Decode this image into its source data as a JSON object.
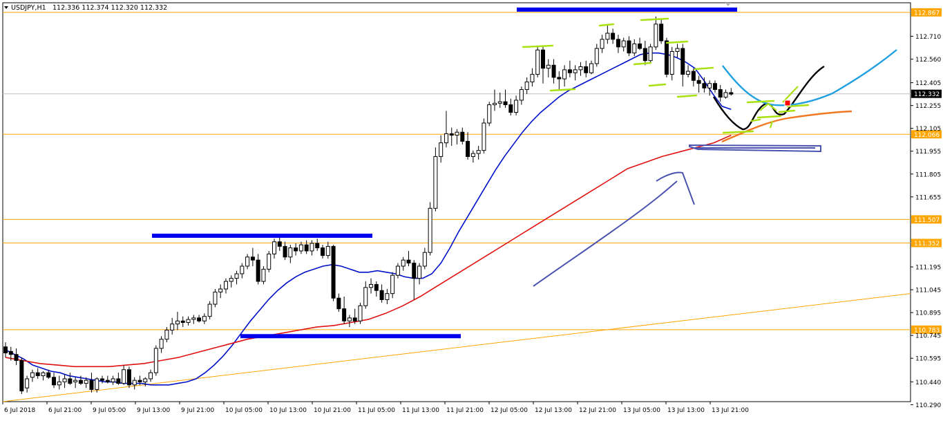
{
  "header": {
    "symbol": "USDJPY,H1",
    "quote": "112.336 112.374 112.320 112.332"
  },
  "colors": {
    "candle_body": "#000000",
    "level_line": "#ffa500",
    "level_tag": "#ffa500",
    "ma_fast": "#0010c8",
    "ma_slow": "#e01010",
    "current_price_tag": "#000000",
    "zone_bar": "#0000ee",
    "drawing_purple": "#4a52b0",
    "drawing_black": "#000000",
    "drawing_lightblue": "#20a0e0",
    "drawing_orange": "#f07820",
    "drawing_lime": "#a8e010",
    "marker_red": "#ff0000"
  },
  "chart_data": {
    "type": "candlestick",
    "timeframe": "H1",
    "symbol": "USDJPY",
    "ylim": [
      110.31,
      112.93
    ],
    "y_ticks": [
      "112.710",
      "112.560",
      "112.405",
      "112.255",
      "112.105",
      "111.955",
      "111.805",
      "111.655",
      "111.195",
      "111.045",
      "110.895",
      "110.745",
      "110.595",
      "110.440",
      "110.290"
    ],
    "x_ticks": [
      "6 Jul 2018",
      "6 Jul 21:00",
      "9 Jul 05:00",
      "9 Jul 13:00",
      "9 Jul 21:00",
      "10 Jul 05:00",
      "10 Jul 13:00",
      "10 Jul 21:00",
      "11 Jul 05:00",
      "11 Jul 13:00",
      "11 Jul 21:00",
      "12 Jul 05:00",
      "12 Jul 13:00",
      "12 Jul 21:00",
      "13 Jul 05:00",
      "13 Jul 13:00",
      "13 Jul 21:00"
    ],
    "current_price": "112.332",
    "horizontal_levels": [
      "112.867",
      "112.066",
      "111.507",
      "111.352",
      "110.783"
    ],
    "candles": [
      [
        110.67,
        110.7,
        110.6,
        110.63
      ],
      [
        110.64,
        110.67,
        110.58,
        110.62
      ],
      [
        110.62,
        110.66,
        110.55,
        110.58
      ],
      [
        110.58,
        110.6,
        110.36,
        110.38
      ],
      [
        110.4,
        110.48,
        110.37,
        110.46
      ],
      [
        110.47,
        110.52,
        110.44,
        110.5
      ],
      [
        110.5,
        110.53,
        110.46,
        110.48
      ],
      [
        110.48,
        110.51,
        110.45,
        110.5
      ],
      [
        110.5,
        110.52,
        110.46,
        110.47
      ],
      [
        110.47,
        110.5,
        110.4,
        110.42
      ],
      [
        110.42,
        110.48,
        110.39,
        110.44
      ],
      [
        110.44,
        110.49,
        110.4,
        110.46
      ],
      [
        110.46,
        110.5,
        110.42,
        110.43
      ],
      [
        110.44,
        110.47,
        110.4,
        110.45
      ],
      [
        110.45,
        110.48,
        110.42,
        110.43
      ],
      [
        110.43,
        110.47,
        110.4,
        110.45
      ],
      [
        110.45,
        110.5,
        110.37,
        110.39
      ],
      [
        110.39,
        110.47,
        110.37,
        110.46
      ],
      [
        110.46,
        110.48,
        110.43,
        110.45
      ],
      [
        110.45,
        110.48,
        110.43,
        110.44
      ],
      [
        110.44,
        110.48,
        110.42,
        110.46
      ],
      [
        110.46,
        110.5,
        110.42,
        110.43
      ],
      [
        110.43,
        110.55,
        110.42,
        110.52
      ],
      [
        110.52,
        110.54,
        110.4,
        110.42
      ],
      [
        110.42,
        110.47,
        110.39,
        110.45
      ],
      [
        110.45,
        110.48,
        110.42,
        110.44
      ],
      [
        110.44,
        110.47,
        110.41,
        110.46
      ],
      [
        110.46,
        110.52,
        110.44,
        110.5
      ],
      [
        110.5,
        110.68,
        110.48,
        110.66
      ],
      [
        110.66,
        110.74,
        110.63,
        110.72
      ],
      [
        110.72,
        110.8,
        110.7,
        110.78
      ],
      [
        110.78,
        110.86,
        110.75,
        110.82
      ],
      [
        110.82,
        110.9,
        110.78,
        110.84
      ],
      [
        110.84,
        110.87,
        110.8,
        110.83
      ],
      [
        110.83,
        110.87,
        110.81,
        110.85
      ],
      [
        110.85,
        110.88,
        110.82,
        110.86
      ],
      [
        110.86,
        110.88,
        110.83,
        110.84
      ],
      [
        110.84,
        110.89,
        110.82,
        110.87
      ],
      [
        110.87,
        110.97,
        110.85,
        110.95
      ],
      [
        110.95,
        111.05,
        110.93,
        111.03
      ],
      [
        111.03,
        111.08,
        110.99,
        111.05
      ],
      [
        111.05,
        111.12,
        111.02,
        111.1
      ],
      [
        111.1,
        111.14,
        111.06,
        111.12
      ],
      [
        111.12,
        111.17,
        111.08,
        111.15
      ],
      [
        111.15,
        111.22,
        111.12,
        111.2
      ],
      [
        111.2,
        111.28,
        111.18,
        111.26
      ],
      [
        111.26,
        111.32,
        111.2,
        111.24
      ],
      [
        111.24,
        111.28,
        111.08,
        111.1
      ],
      [
        111.1,
        111.2,
        111.08,
        111.18
      ],
      [
        111.18,
        111.3,
        111.16,
        111.28
      ],
      [
        111.28,
        111.38,
        111.25,
        111.36
      ],
      [
        111.36,
        111.41,
        111.3,
        111.33
      ],
      [
        111.33,
        111.36,
        111.24,
        111.26
      ],
      [
        111.26,
        111.34,
        111.22,
        111.32
      ],
      [
        111.32,
        111.35,
        111.27,
        111.3
      ],
      [
        111.3,
        111.36,
        111.28,
        111.34
      ],
      [
        111.34,
        111.37,
        111.28,
        111.3
      ],
      [
        111.3,
        111.37,
        111.27,
        111.35
      ],
      [
        111.35,
        111.38,
        111.3,
        111.32
      ],
      [
        111.32,
        111.34,
        111.25,
        111.27
      ],
      [
        111.27,
        111.36,
        111.25,
        111.33
      ],
      [
        111.33,
        111.34,
        110.97,
        110.99
      ],
      [
        110.99,
        111.02,
        110.9,
        110.92
      ],
      [
        110.92,
        111.0,
        110.82,
        110.84
      ],
      [
        110.84,
        110.88,
        110.8,
        110.86
      ],
      [
        110.86,
        110.92,
        110.82,
        110.84
      ],
      [
        110.84,
        110.96,
        110.82,
        110.94
      ],
      [
        110.94,
        111.1,
        110.92,
        111.06
      ],
      [
        111.06,
        111.12,
        111.02,
        111.08
      ],
      [
        111.08,
        111.1,
        111.0,
        111.04
      ],
      [
        111.04,
        111.08,
        110.96,
        110.98
      ],
      [
        110.98,
        111.05,
        110.95,
        111.02
      ],
      [
        111.02,
        111.16,
        110.99,
        111.14
      ],
      [
        111.14,
        111.22,
        111.12,
        111.2
      ],
      [
        111.2,
        111.26,
        111.17,
        111.24
      ],
      [
        111.24,
        111.3,
        111.2,
        111.22
      ],
      [
        111.22,
        111.24,
        110.98,
        111.12
      ],
      [
        111.12,
        111.22,
        111.08,
        111.2
      ],
      [
        111.2,
        111.32,
        111.18,
        111.29
      ],
      [
        111.29,
        111.62,
        111.27,
        111.58
      ],
      [
        111.58,
        111.98,
        111.56,
        111.92
      ],
      [
        111.92,
        112.06,
        111.88,
        112.01
      ],
      [
        112.01,
        112.22,
        111.98,
        112.07
      ],
      [
        112.07,
        112.11,
        111.99,
        112.06
      ],
      [
        112.06,
        112.1,
        112.0,
        112.08
      ],
      [
        112.08,
        112.11,
        112.0,
        112.02
      ],
      [
        112.02,
        112.08,
        111.9,
        111.92
      ],
      [
        111.92,
        111.96,
        111.88,
        111.94
      ],
      [
        111.94,
        111.99,
        111.9,
        111.96
      ],
      [
        111.96,
        112.17,
        111.94,
        112.14
      ],
      [
        112.14,
        112.28,
        112.12,
        112.26
      ],
      [
        112.26,
        112.36,
        112.22,
        112.27
      ],
      [
        112.27,
        112.34,
        112.24,
        112.28
      ],
      [
        112.28,
        112.36,
        112.24,
        112.26
      ],
      [
        112.26,
        112.3,
        112.19,
        112.21
      ],
      [
        112.21,
        112.32,
        112.19,
        112.29
      ],
      [
        112.29,
        112.38,
        112.26,
        112.36
      ],
      [
        112.36,
        112.44,
        112.33,
        112.41
      ],
      [
        112.41,
        112.5,
        112.38,
        112.46
      ],
      [
        112.46,
        112.64,
        112.44,
        112.62
      ],
      [
        112.62,
        112.64,
        112.4,
        112.5
      ],
      [
        112.5,
        112.56,
        112.44,
        112.52
      ],
      [
        112.52,
        112.56,
        112.4,
        112.44
      ],
      [
        112.44,
        112.48,
        112.36,
        112.43
      ],
      [
        112.43,
        112.52,
        112.38,
        112.49
      ],
      [
        112.49,
        112.55,
        112.44,
        112.47
      ],
      [
        112.47,
        112.52,
        112.42,
        112.49
      ],
      [
        112.49,
        112.54,
        112.45,
        112.51
      ],
      [
        112.51,
        112.55,
        112.44,
        112.47
      ],
      [
        112.47,
        112.55,
        112.46,
        112.53
      ],
      [
        112.53,
        112.66,
        112.51,
        112.63
      ],
      [
        112.63,
        112.72,
        112.6,
        112.69
      ],
      [
        112.69,
        112.78,
        112.66,
        112.73
      ],
      [
        112.73,
        112.76,
        112.66,
        112.69
      ],
      [
        112.69,
        112.72,
        112.6,
        112.64
      ],
      [
        112.64,
        112.7,
        112.61,
        112.68
      ],
      [
        112.68,
        112.71,
        112.58,
        112.6
      ],
      [
        112.6,
        112.69,
        112.58,
        112.66
      ],
      [
        112.66,
        112.7,
        112.62,
        112.63
      ],
      [
        112.63,
        112.68,
        112.52,
        112.55
      ],
      [
        112.55,
        112.66,
        112.53,
        112.64
      ],
      [
        112.64,
        112.84,
        112.62,
        112.79
      ],
      [
        112.79,
        112.82,
        112.66,
        112.68
      ],
      [
        112.68,
        112.7,
        112.44,
        112.46
      ],
      [
        112.46,
        112.64,
        112.42,
        112.61
      ],
      [
        112.61,
        112.66,
        112.57,
        112.63
      ],
      [
        112.63,
        112.66,
        112.38,
        112.46
      ],
      [
        112.46,
        112.52,
        112.44,
        112.48
      ],
      [
        112.48,
        112.5,
        112.38,
        112.42
      ],
      [
        112.42,
        112.45,
        112.34,
        112.4
      ],
      [
        112.4,
        112.44,
        112.34,
        112.37
      ],
      [
        112.37,
        112.42,
        112.32,
        112.4
      ],
      [
        112.4,
        112.42,
        112.34,
        112.36
      ],
      [
        112.36,
        112.39,
        112.28,
        112.31
      ],
      [
        112.31,
        112.36,
        112.3,
        112.34
      ],
      [
        112.34,
        112.37,
        112.32,
        112.33
      ]
    ],
    "moving_averages": [
      {
        "color_key": "ma_fast",
        "values": [
          110.65,
          110.62,
          110.59,
          110.55,
          110.53,
          110.51,
          110.5,
          110.48,
          110.47,
          110.46,
          110.45,
          110.44,
          110.44,
          110.43,
          110.43,
          110.43,
          110.42,
          110.42,
          110.42,
          110.43,
          110.44,
          110.46,
          110.5,
          110.55,
          110.61,
          110.68,
          110.76,
          110.84,
          110.91,
          110.98,
          111.04,
          111.09,
          111.13,
          111.16,
          111.18,
          111.2,
          111.21,
          111.2,
          111.18,
          111.16,
          111.16,
          111.17,
          111.16,
          111.15,
          111.13,
          111.12,
          111.12,
          111.15,
          111.22,
          111.32,
          111.43,
          111.53,
          111.63,
          111.73,
          111.83,
          111.92,
          112.0,
          112.08,
          112.15,
          112.21,
          112.26,
          112.31,
          112.35,
          112.38,
          112.41,
          112.44,
          112.47,
          112.5,
          112.53,
          112.56,
          112.59,
          112.6,
          112.6,
          112.59,
          112.57,
          112.54,
          112.5,
          112.42,
          112.33,
          112.25,
          112.23
        ]
      },
      {
        "color_key": "ma_slow",
        "values": [
          110.6,
          110.58,
          110.56,
          110.55,
          110.54,
          110.54,
          110.54,
          110.55,
          110.56,
          110.58,
          110.6,
          110.63,
          110.66,
          110.69,
          110.72,
          110.74,
          110.76,
          110.78,
          110.8,
          110.81,
          110.83,
          110.85,
          110.89,
          110.94,
          111.0,
          111.07,
          111.14,
          111.21,
          111.28,
          111.35,
          111.42,
          111.49,
          111.56,
          111.63,
          111.7,
          111.77,
          111.84,
          111.88,
          111.92,
          111.95,
          111.98,
          112.01,
          112.06
        ]
      }
    ]
  },
  "drawings": {
    "resistance_zone_top": "zone above 12 Jul highs",
    "resistance_zone_mid": "zone at 10 Jul highs",
    "support_zone": "zone at 10 Jul lows"
  }
}
